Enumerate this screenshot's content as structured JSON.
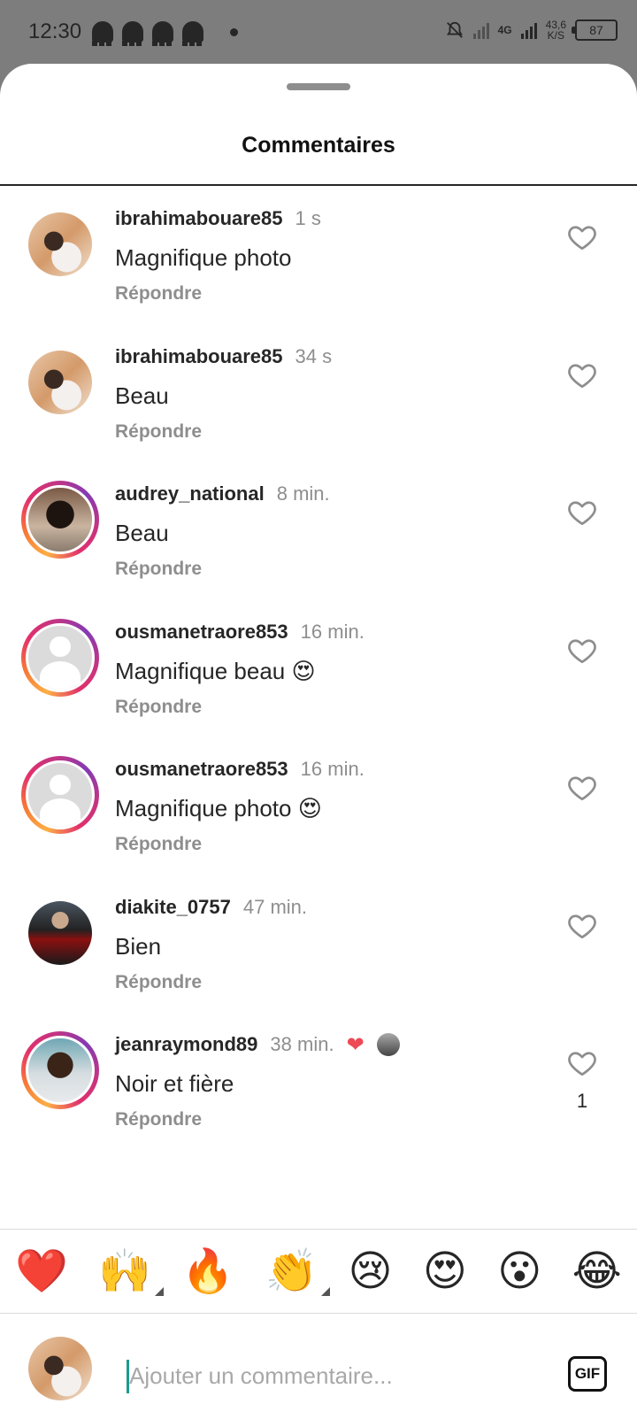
{
  "status_bar": {
    "time": "12:30",
    "network": "4G",
    "speed_value": "43,6",
    "speed_unit": "K/S",
    "battery": "87"
  },
  "sheet": {
    "title": "Commentaires"
  },
  "comments": [
    {
      "username": "ibrahimabouare85",
      "time": "1 s",
      "text": "Magnifique photo",
      "reply_label": "Répondre",
      "avatar": "photo-1",
      "story_ring": false,
      "likes": ""
    },
    {
      "username": "ibrahimabouare85",
      "time": "34 s",
      "text": "Beau",
      "reply_label": "Répondre",
      "avatar": "photo-1",
      "story_ring": false,
      "likes": ""
    },
    {
      "username": "audrey_national",
      "time": "8 min.",
      "text": "Beau",
      "reply_label": "Répondre",
      "avatar": "photo-2",
      "story_ring": true,
      "likes": ""
    },
    {
      "username": "ousmanetraore853",
      "time": "16 min.",
      "text": "Magnifique beau 😍",
      "reply_label": "Répondre",
      "avatar": "default",
      "story_ring": true,
      "likes": ""
    },
    {
      "username": "ousmanetraore853",
      "time": "16 min.",
      "text": "Magnifique photo 😍",
      "reply_label": "Répondre",
      "avatar": "default",
      "story_ring": true,
      "likes": ""
    },
    {
      "username": "diakite_0757",
      "time": "47 min.",
      "text": "Bien",
      "reply_label": "Répondre",
      "avatar": "photo-3",
      "story_ring": false,
      "likes": ""
    },
    {
      "username": "jeanraymond89",
      "time": "38 min.",
      "text": "Noir et fière",
      "reply_label": "Répondre",
      "avatar": "photo-4",
      "story_ring": true,
      "likes": "1",
      "author_liked": true
    }
  ],
  "reactions": [
    "❤️",
    "🙌",
    "🔥",
    "👏",
    "😢",
    "😍",
    "😮",
    "😂"
  ],
  "composer": {
    "placeholder": "Ajouter un commentaire...",
    "gif_label": "GIF"
  },
  "icons": {
    "like": "heart-outline-icon",
    "nav_recent": "square-icon",
    "nav_home": "circle-icon",
    "nav_back": "triangle-back-icon"
  },
  "colors": {
    "accent_heart": "#ed4956",
    "muted_text": "#8e8e8e",
    "cursor": "#1a9c8c"
  }
}
